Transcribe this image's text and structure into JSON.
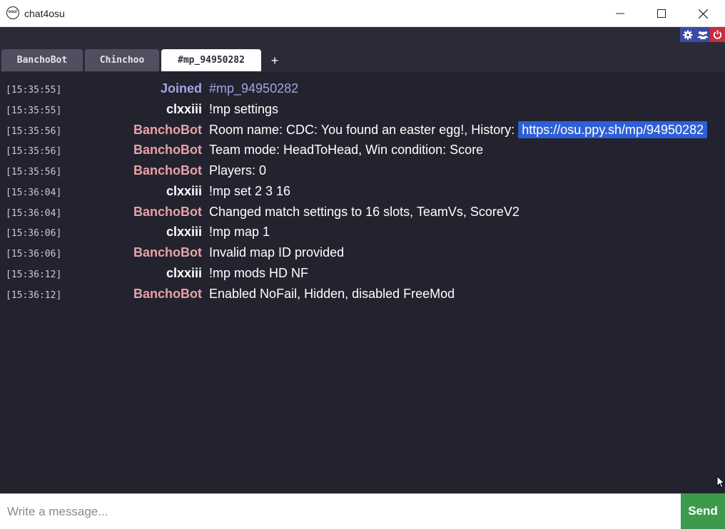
{
  "window": {
    "title": "chat4osu",
    "icon_text": "osu!"
  },
  "colors": {
    "bot": "#e9a1a6",
    "user": "#ffffff",
    "joined": "#a4a3e2",
    "text": "#ffffff",
    "accent_send": "#3d9a4d",
    "link_bg": "#2f5fd6"
  },
  "tabs": [
    {
      "label": "BanchoBot",
      "active": false
    },
    {
      "label": "Chinchoo",
      "active": false
    },
    {
      "label": "#mp_94950282",
      "active": true
    }
  ],
  "add_tab_label": "+",
  "toolbar_icons": [
    "gear-icon",
    "users-icon",
    "power-icon"
  ],
  "messages": [
    {
      "time": "[15:35:55]",
      "user": "Joined",
      "kind": "joined",
      "text": "#mp_94950282"
    },
    {
      "time": "[15:35:55]",
      "user": "clxxiii",
      "kind": "user",
      "text": "!mp settings"
    },
    {
      "time": "[15:35:56]",
      "user": "BanchoBot",
      "kind": "bot",
      "text": "Room name: CDC: You found an easter egg!, History:",
      "link": "https://osu.ppy.sh/mp/94950282"
    },
    {
      "time": "[15:35:56]",
      "user": "BanchoBot",
      "kind": "bot",
      "text": "Team mode: HeadToHead, Win condition: Score"
    },
    {
      "time": "[15:35:56]",
      "user": "BanchoBot",
      "kind": "bot",
      "text": "Players: 0"
    },
    {
      "time": "[15:36:04]",
      "user": "clxxiii",
      "kind": "user",
      "text": "!mp set 2 3 16"
    },
    {
      "time": "[15:36:04]",
      "user": "BanchoBot",
      "kind": "bot",
      "text": "Changed match settings to 16 slots, TeamVs, ScoreV2"
    },
    {
      "time": "[15:36:06]",
      "user": "clxxiii",
      "kind": "user",
      "text": "!mp map 1"
    },
    {
      "time": "[15:36:06]",
      "user": "BanchoBot",
      "kind": "bot",
      "text": "Invalid map ID provided"
    },
    {
      "time": "[15:36:12]",
      "user": "clxxiii",
      "kind": "user",
      "text": "!mp mods HD NF"
    },
    {
      "time": "[15:36:12]",
      "user": "BanchoBot",
      "kind": "bot",
      "text": "Enabled NoFail, Hidden, disabled FreeMod"
    }
  ],
  "input": {
    "placeholder": "Write a message...",
    "value": ""
  },
  "send_label": "Send"
}
